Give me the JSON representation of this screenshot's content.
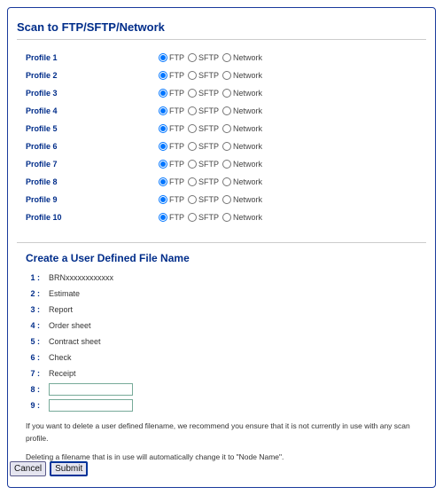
{
  "title": "Scan to FTP/SFTP/Network",
  "radio_labels": {
    "ftp": "FTP",
    "sftp": "SFTP",
    "network": "Network"
  },
  "profiles": [
    {
      "label": "Profile 1",
      "selected": "ftp"
    },
    {
      "label": "Profile 2",
      "selected": "ftp"
    },
    {
      "label": "Profile 3",
      "selected": "ftp"
    },
    {
      "label": "Profile 4",
      "selected": "ftp"
    },
    {
      "label": "Profile 5",
      "selected": "ftp"
    },
    {
      "label": "Profile 6",
      "selected": "ftp"
    },
    {
      "label": "Profile 7",
      "selected": "ftp"
    },
    {
      "label": "Profile 8",
      "selected": "ftp"
    },
    {
      "label": "Profile 9",
      "selected": "ftp"
    },
    {
      "label": "Profile 10",
      "selected": "ftp"
    }
  ],
  "section2_title": "Create a User Defined File Name",
  "filenames": [
    {
      "n": "1",
      "value": "BRNxxxxxxxxxxxx",
      "editable": false
    },
    {
      "n": "2",
      "value": "Estimate",
      "editable": false
    },
    {
      "n": "3",
      "value": "Report",
      "editable": false
    },
    {
      "n": "4",
      "value": "Order sheet",
      "editable": false
    },
    {
      "n": "5",
      "value": "Contract sheet",
      "editable": false
    },
    {
      "n": "6",
      "value": "Check",
      "editable": false
    },
    {
      "n": "7",
      "value": "Receipt",
      "editable": false
    },
    {
      "n": "8",
      "value": "",
      "editable": true
    },
    {
      "n": "9",
      "value": "",
      "editable": true
    }
  ],
  "hint1": "If you want to delete a user defined filename, we recommend you ensure that it is not currently in use with any scan profile.",
  "hint2": "Deleting a filename that is in use will automatically change it to \"Node Name\".",
  "buttons": {
    "cancel": "Cancel",
    "submit": "Submit"
  }
}
